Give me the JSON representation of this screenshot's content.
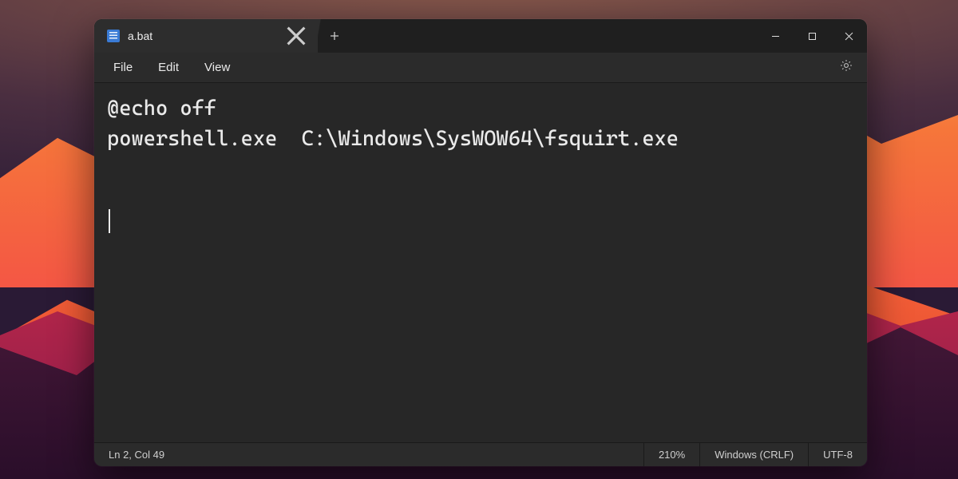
{
  "tab": {
    "title": "a.bat"
  },
  "menu": {
    "file": "File",
    "edit": "Edit",
    "view": "View"
  },
  "content": {
    "line1": "@echo off",
    "line2": "powershell.exe  C:\\Windows\\SysWOW64\\fsquirt.exe"
  },
  "status": {
    "position": "Ln 2, Col 49",
    "zoom": "210%",
    "eol": "Windows (CRLF)",
    "encoding": "UTF-8"
  }
}
